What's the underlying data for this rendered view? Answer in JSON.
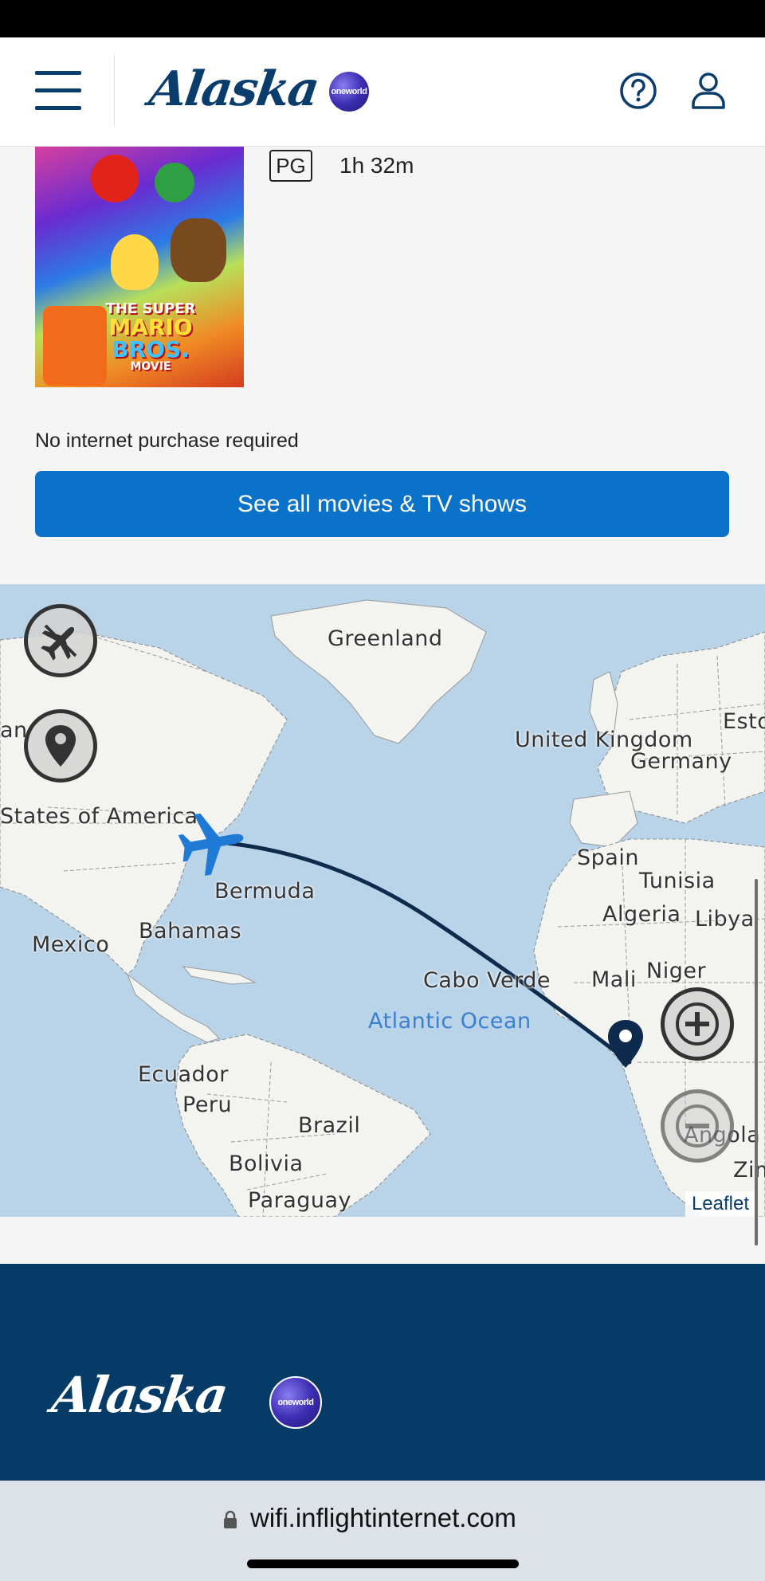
{
  "header": {
    "menu_icon": "hamburger-menu-icon",
    "brand": "Alaska",
    "alliance_badge": "oneworld",
    "help_icon": "question-circle-icon",
    "account_icon": "user-icon"
  },
  "movie": {
    "poster": {
      "line1": "THE SUPER",
      "line2": "MARIO",
      "line3": "BROS.",
      "line4": "MOVIE"
    },
    "rating": "PG",
    "duration": "1h 32m",
    "notice": "No internet purchase required",
    "cta_label": "See all movies & TV shows"
  },
  "map": {
    "labels": {
      "greenland": "Greenland",
      "usa": "States of America",
      "canada_fragment": "an",
      "uk": "United Kingdom",
      "germany": "Germany",
      "estonia": "Esto",
      "spain": "Spain",
      "tunisia": "Tunisia",
      "algeria": "Algeria",
      "libya": "Libya",
      "bermuda": "Bermuda",
      "bahamas": "Bahamas",
      "mexico": "Mexico",
      "cabo_verde": "Cabo Verde",
      "mali": "Mali",
      "niger": "Niger",
      "atlantic": "Atlantic Ocean",
      "ecuador": "Ecuador",
      "peru": "Peru",
      "brazil": "Brazil",
      "bolivia": "Bolivia",
      "paraguay": "Paraguay",
      "angola": "Angola",
      "zimbabwe": "Zim"
    },
    "controls": {
      "flight_button_icon": "airplane-icon",
      "location_button_icon": "map-pin-icon",
      "zoom_in_icon": "plus-icon",
      "zoom_out_icon": "minus-icon"
    },
    "attribution": "Leaflet"
  },
  "footer": {
    "brand": "Alaska",
    "alliance_badge": "oneworld"
  },
  "browser": {
    "url": "wifi.inflightinternet.com",
    "lock_icon": "lock-icon"
  },
  "colors": {
    "brand_navy": "#0a3d6b",
    "cta_blue": "#0b72c9",
    "footer_navy": "#053b66",
    "plane_blue": "#1f7ad6"
  }
}
